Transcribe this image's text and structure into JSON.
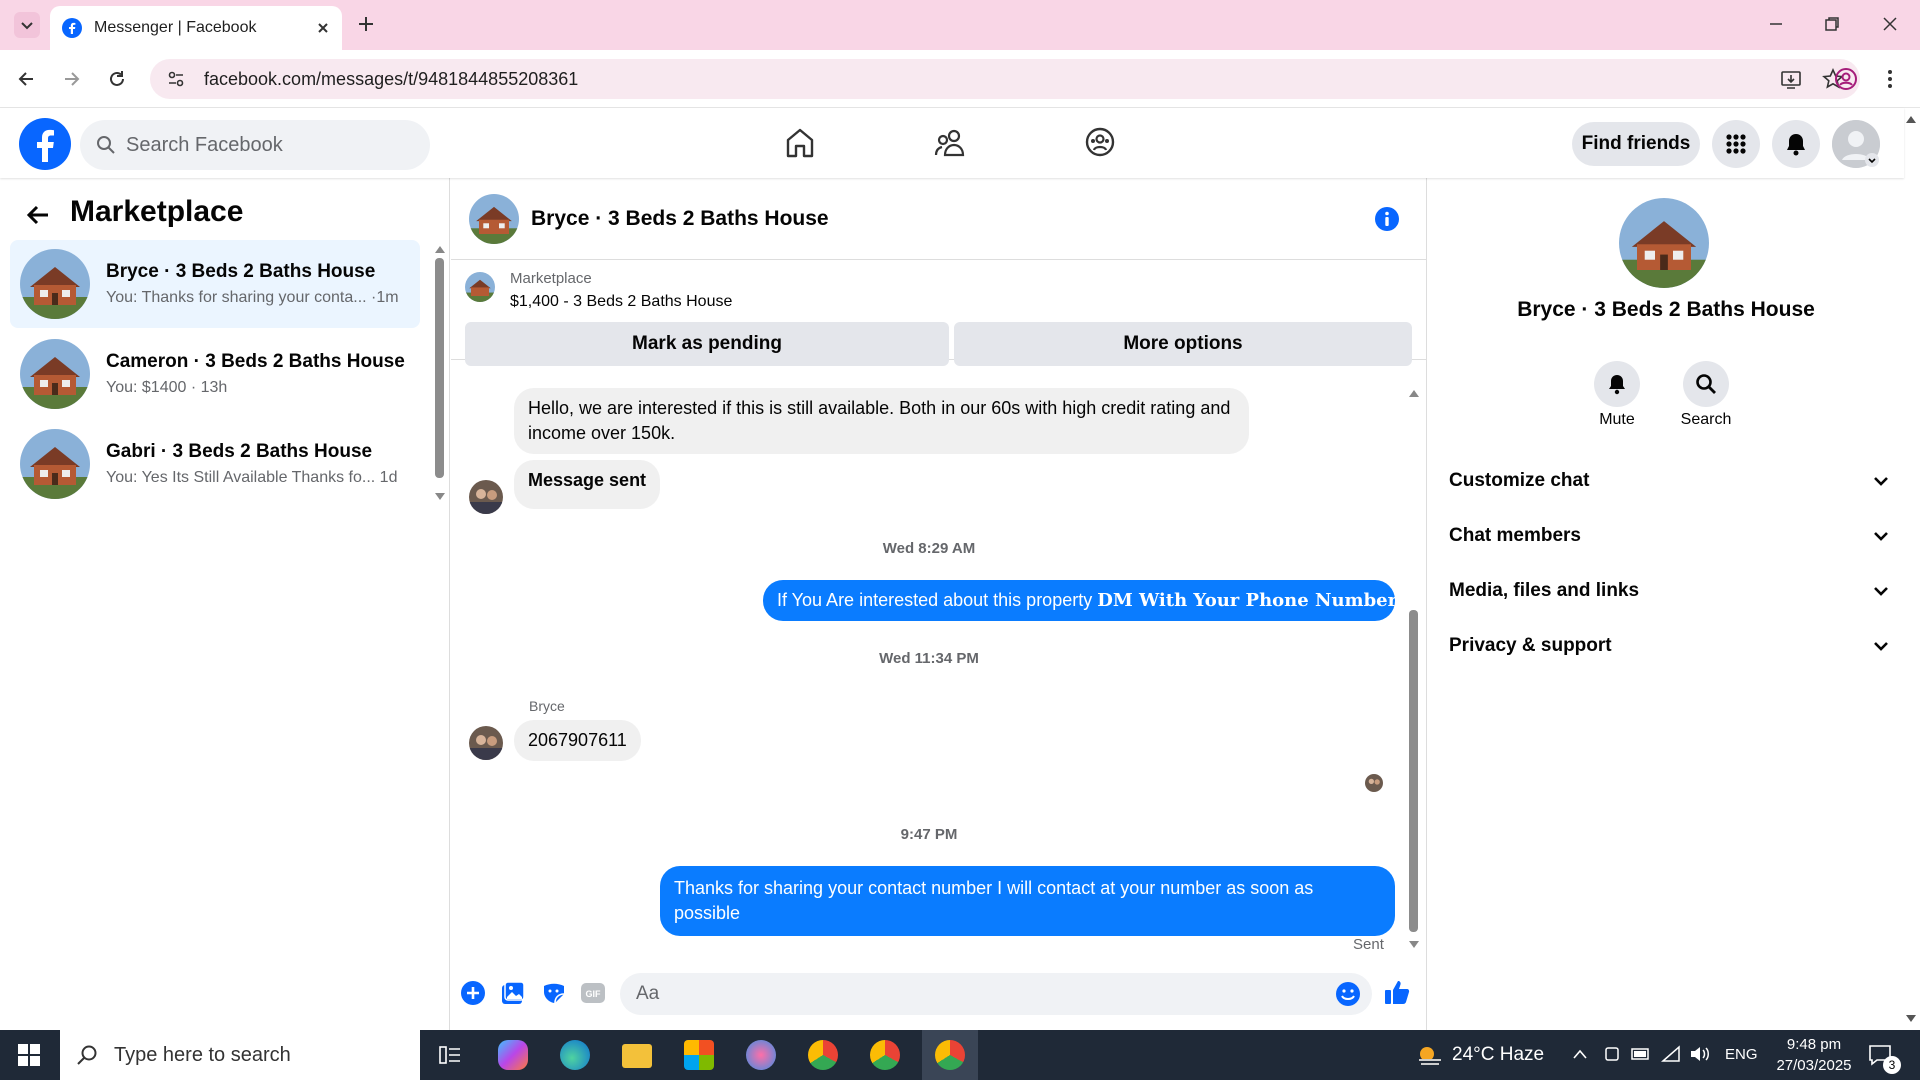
{
  "browser": {
    "tab_title": "Messenger | Facebook",
    "url": "facebook.com/messages/t/9481844855208361"
  },
  "fb": {
    "search_placeholder": "Search Facebook",
    "find_friends": "Find friends"
  },
  "left": {
    "title": "Marketplace",
    "conversations": [
      {
        "name": "Bryce · 3 Beds 2 Baths House",
        "preview": "You: Thanks for sharing your conta... ·1m"
      },
      {
        "name": "Cameron · 3 Beds 2 Baths House",
        "preview": "You: $1400 · 13h"
      },
      {
        "name": "Gabri · 3 Beds 2 Baths House",
        "preview": "You: Yes Its Still Available Thanks fo...  1d"
      }
    ]
  },
  "chat": {
    "title": "Bryce · 3 Beds 2 Baths House",
    "marketplace_label": "Marketplace",
    "listing": "$1,400 - 3 Beds 2 Baths House",
    "mark_pending": "Mark as pending",
    "more_options": "More options",
    "messages": {
      "m1": "Hello, we are interested if this is still available. Both in our 60s with high credit rating and income over 150k.",
      "m2": "Message sent",
      "ts1": "Wed 8:29 AM",
      "m3_a": "If You Are interested about this property ",
      "m3_b": "DM With Your Phone Number",
      "ts2": "Wed 11:34 PM",
      "sender": "Bryce",
      "m4": "2067907611",
      "ts3": "9:47 PM",
      "m5": "Thanks for sharing your contact number I will contact at your number as soon as possible",
      "status": "Sent"
    },
    "composer_placeholder": "Aa"
  },
  "right": {
    "name": "Bryce · 3 Beds 2 Baths House",
    "mute": "Mute",
    "search": "Search",
    "sections": [
      "Customize chat",
      "Chat members",
      "Media, files and links",
      "Privacy & support"
    ]
  },
  "taskbar": {
    "search_placeholder": "Type here to search",
    "weather": "24°C  Haze",
    "lang": "ENG",
    "time": "9:48 pm",
    "date": "27/03/2025",
    "notifications": "3"
  },
  "colors": {
    "fb_blue": "#0866ff",
    "bubble_out": "#0a7cff"
  }
}
